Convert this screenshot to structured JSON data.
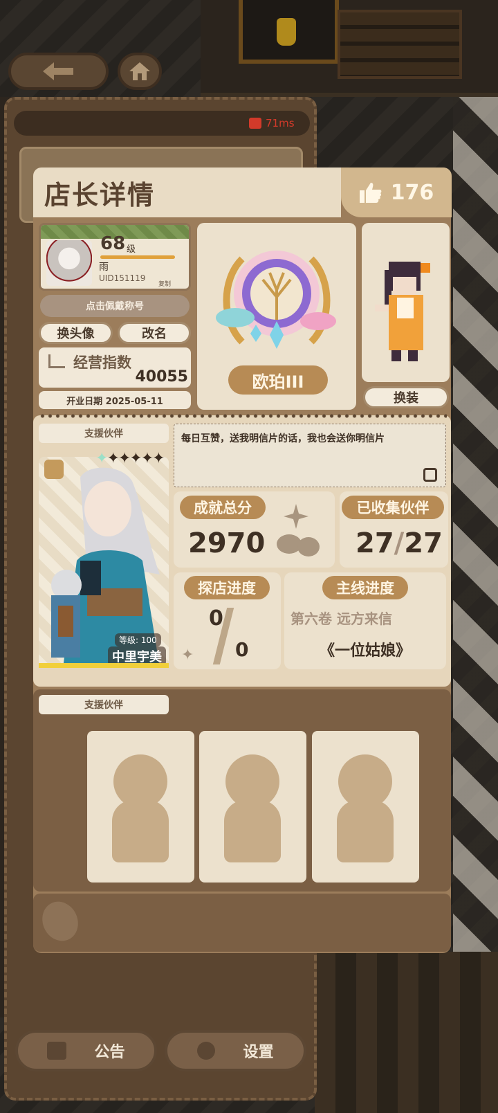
{
  "network": {
    "ping": "71ms"
  },
  "modal": {
    "title": "店长详情",
    "likes": "176"
  },
  "profile": {
    "level": "68",
    "level_unit": "级",
    "name": "雨",
    "uid": "UID151119",
    "copy_label": "复制",
    "title_button": "点击佩戴称号",
    "change_avatar": "换头像",
    "rename": "改名",
    "business_index_label": "经营指数",
    "business_index_value": "40055",
    "open_date": "开业日期 2025-05-11"
  },
  "rank": {
    "name": "欧珀III",
    "outfit_button": "换装"
  },
  "partner": {
    "label": "支援伙伴",
    "level_text": "等级: 100",
    "name": "中里宇美",
    "stars": "✦✦✦✦✦"
  },
  "signature": "每日互赞，送我明信片的话，我也会送你明信片",
  "stats": {
    "achievement_label": "成就总分",
    "achievement_value": "2970",
    "collected_label": "已收集伙伴",
    "collected_have": "27",
    "collected_total": "27",
    "explore_label": "探店进度",
    "explore_have": "0",
    "explore_total": "0",
    "story_label": "主线进度",
    "story_volume": "第六卷 远方来信",
    "story_chapter": "《一位姑娘》"
  },
  "support": {
    "label": "支援伙伴",
    "slots": [
      "empty",
      "empty",
      "empty"
    ]
  },
  "bottom_bar": {
    "notice": "公告",
    "settings": "设置"
  },
  "icons": {
    "back": "arrow-left-icon",
    "home": "home-icon",
    "like": "thumbs-up-icon",
    "edit": "edit-icon"
  }
}
